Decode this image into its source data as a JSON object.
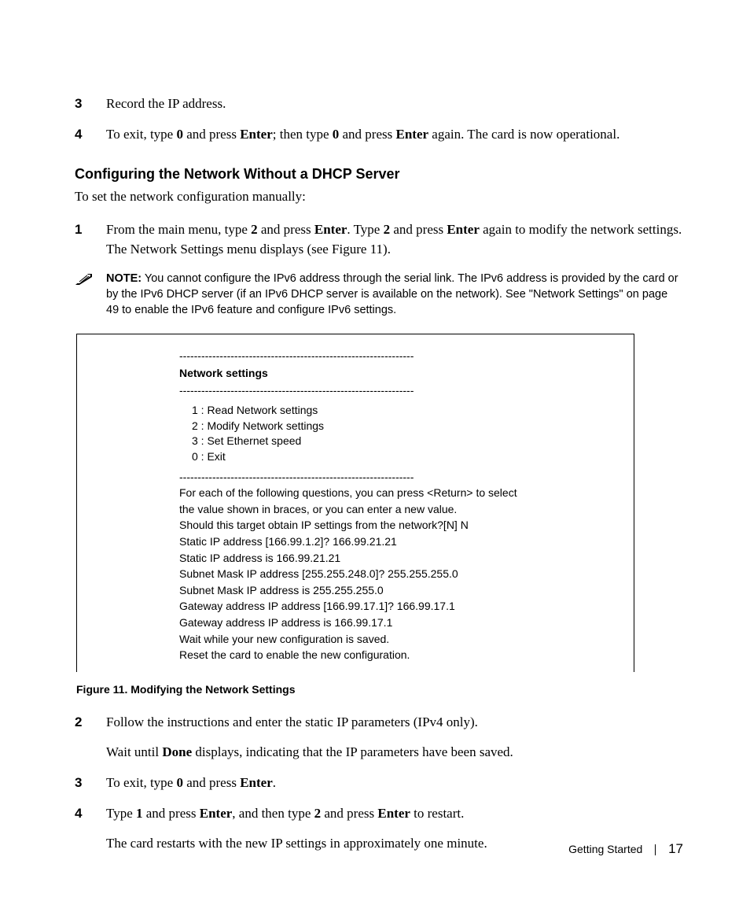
{
  "steps_top": [
    {
      "num": "3",
      "text": "Record the IP address."
    },
    {
      "num": "4",
      "parts": [
        "To exit, type ",
        "0",
        " and press ",
        "Enter",
        "; then type ",
        "0",
        " and press ",
        "Enter",
        " again. The card is now operational."
      ]
    }
  ],
  "section": {
    "heading": "Configuring the Network Without a DHCP Server",
    "intro": "To set the network configuration manually:"
  },
  "step1": {
    "num": "1",
    "parts": [
      "From the main menu, type ",
      "2",
      " and press ",
      "Enter",
      ". Type ",
      "2",
      " and press ",
      "Enter",
      " again to modify the network settings. The Network Settings menu displays (see Figure 11)."
    ]
  },
  "note": {
    "label": "NOTE:",
    "text": " You cannot configure the IPv6 address through the serial link. The IPv6 address is provided by the card or by the IPv6 DHCP server (if an IPv6 DHCP server is available on the network). See \"Network Settings\" on page 49 to enable the IPv6 feature and configure IPv6 settings."
  },
  "figure": {
    "dashes": "----------------------------------------------------------------",
    "title": "Network settings",
    "menu": [
      "1 : Read Network settings",
      "2 : Modify Network settings",
      "3 : Set Ethernet speed",
      "0 : Exit"
    ],
    "body": [
      "For each of the following questions, you can press <Return> to select",
      "the value shown in braces, or you can enter a new value.",
      "Should this target obtain IP settings from the network?[N] N",
      "Static IP address [166.99.1.2]? 166.99.21.21",
      "Static IP address is 166.99.21.21",
      "Subnet Mask IP address [255.255.248.0]? 255.255.255.0",
      "Subnet Mask IP address is 255.255.255.0",
      "Gateway address IP address [166.99.17.1]? 166.99.17.1",
      "Gateway address IP address is 166.99.17.1",
      "Wait while your new configuration is saved.",
      "Reset the card to enable the new configuration."
    ],
    "caption": "Figure 11. Modifying the Network Settings"
  },
  "steps_bottom": {
    "s2": {
      "num": "2",
      "line1": "Follow the instructions and enter the static IP parameters (IPv4 only).",
      "line2_parts": [
        "Wait until ",
        "Done",
        " displays, indicating that the IP parameters have been saved."
      ]
    },
    "s3": {
      "num": "3",
      "parts": [
        "To exit, type ",
        "0",
        " and press ",
        "Enter",
        "."
      ]
    },
    "s4": {
      "num": "4",
      "parts": [
        "Type ",
        "1",
        " and press ",
        "Enter",
        ", and then type ",
        "2",
        " and press ",
        "Enter",
        " to restart."
      ],
      "line2": "The card restarts with the new IP settings in approximately one minute."
    }
  },
  "footer": {
    "section": "Getting Started",
    "page": "17"
  }
}
